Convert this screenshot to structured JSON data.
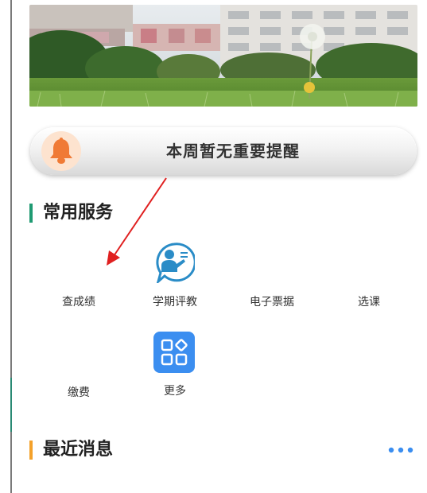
{
  "notice": {
    "text": "本周暂无重要提醒",
    "icon": "bell-icon",
    "color": "#f07a35"
  },
  "services": {
    "title": "常用服务",
    "accent": "#1f9a72",
    "items": [
      {
        "label": "查成绩",
        "icon": ""
      },
      {
        "label": "学期评教",
        "icon": "teacher-icon",
        "color": "#2a8cc7"
      },
      {
        "label": "电子票据",
        "icon": ""
      },
      {
        "label": "选课",
        "icon": ""
      },
      {
        "label": "缴费",
        "icon": ""
      },
      {
        "label": "更多",
        "icon": "apps-icon",
        "color": "#3b8ef0"
      }
    ]
  },
  "news": {
    "title": "最近消息",
    "accent": "#f4a12a",
    "more_icon": "more-dots-icon",
    "more_color": "#3b8ef0"
  },
  "annotation": {
    "color": "#e02020"
  }
}
